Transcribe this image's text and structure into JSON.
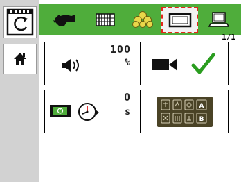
{
  "tabs": [
    {
      "icon": "tractor-icon"
    },
    {
      "icon": "radiator-icon"
    },
    {
      "icon": "coins-icon"
    },
    {
      "icon": "display-icon",
      "selected": true
    },
    {
      "icon": "laptop-icon"
    }
  ],
  "page_indicator": "1/1",
  "tiles": {
    "volume": {
      "value": "100",
      "unit": "%"
    },
    "camera": {
      "checked": true
    },
    "screen_timeout": {
      "value": "0",
      "unit": "s"
    },
    "keypad": {}
  },
  "colors": {
    "tab_bar": "#4fad3b",
    "selection_dash": "#e3271b",
    "check": "#2a9d1f",
    "sidebar": "#d2d2d2",
    "keypad_bg": "#4a4326"
  }
}
